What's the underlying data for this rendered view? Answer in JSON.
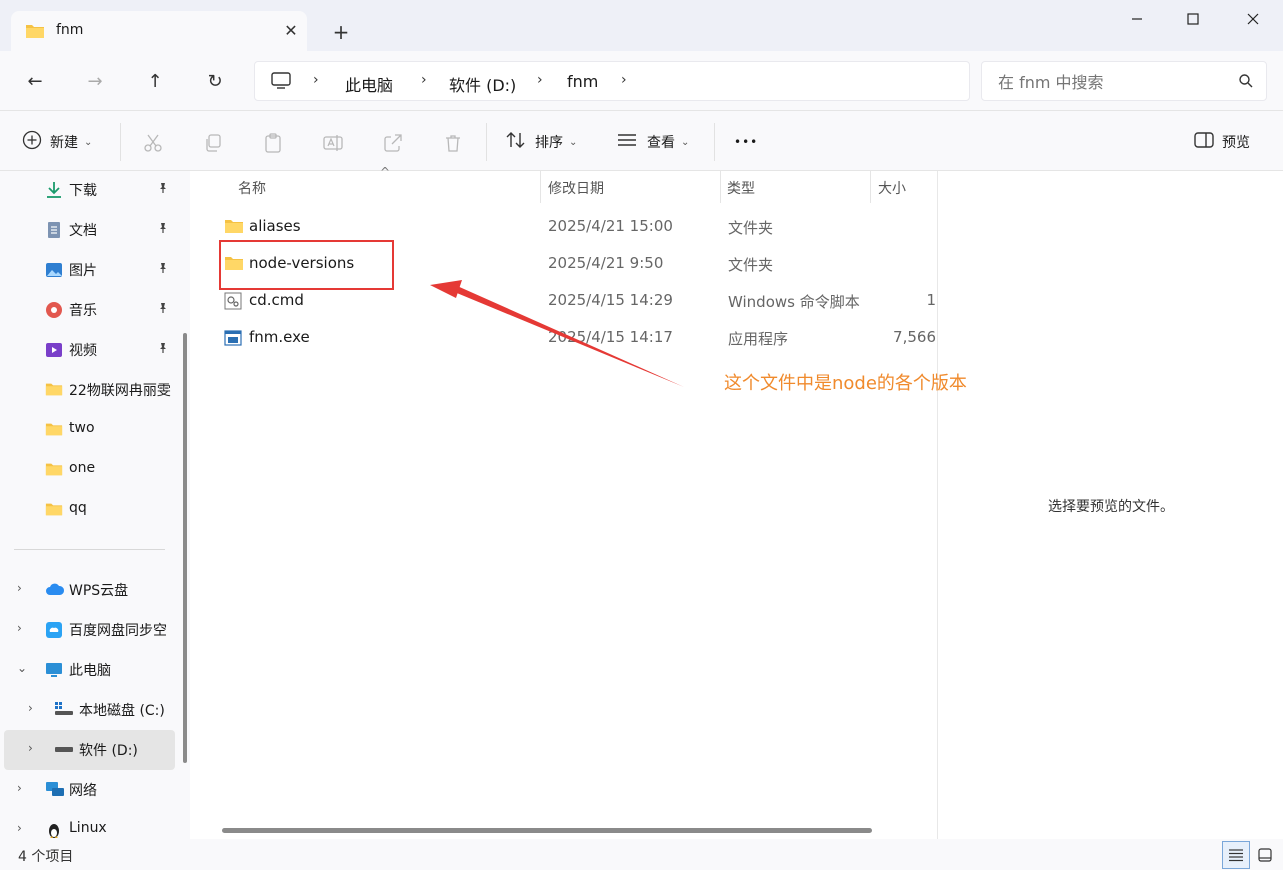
{
  "tab": {
    "title": "fnm",
    "close": "✕",
    "new": "+"
  },
  "window": {
    "minimize": "—",
    "maximize": "☐",
    "close": "✕"
  },
  "nav": {
    "back": "←",
    "forward": "→",
    "up": "↑",
    "refresh": "↻",
    "breadcrumb": [
      "此电脑",
      "软件 (D:)",
      "fnm"
    ],
    "chevron": "›",
    "search_placeholder": "在 fnm 中搜索"
  },
  "toolbar": {
    "new_label": "新建",
    "sort_label": "排序",
    "view_label": "查看",
    "more_label": "•••",
    "preview_label": "预览",
    "dropdown": "⌄"
  },
  "sidebar": {
    "quick": [
      {
        "label": "下载",
        "icon": "download-icon",
        "pinned": true
      },
      {
        "label": "文档",
        "icon": "document-icon",
        "pinned": true
      },
      {
        "label": "图片",
        "icon": "picture-icon",
        "pinned": true
      },
      {
        "label": "音乐",
        "icon": "music-icon",
        "pinned": true
      },
      {
        "label": "视频",
        "icon": "video-icon",
        "pinned": true
      },
      {
        "label": "22物联网冉丽雯",
        "icon": "folder-icon",
        "pinned": false
      },
      {
        "label": "two",
        "icon": "folder-icon",
        "pinned": false
      },
      {
        "label": "one",
        "icon": "folder-icon",
        "pinned": false
      },
      {
        "label": "qq",
        "icon": "folder-icon",
        "pinned": false
      }
    ],
    "tree": [
      {
        "label": "WPS云盘",
        "icon": "cloud-icon",
        "expand": "›"
      },
      {
        "label": "百度网盘同步空",
        "icon": "baidu-netdisk-icon",
        "expand": "›"
      },
      {
        "label": "此电脑",
        "icon": "computer-icon",
        "expand": "⌄"
      },
      {
        "label": "本地磁盘 (C:)",
        "icon": "windows-drive-icon",
        "expand": "›"
      },
      {
        "label": "软件 (D:)",
        "icon": "drive-icon",
        "expand": "›"
      },
      {
        "label": "网络",
        "icon": "network-icon",
        "expand": "›"
      },
      {
        "label": "Linux",
        "icon": "linux-penguin-icon",
        "expand": "›"
      }
    ],
    "pin_glyph": "📌"
  },
  "columns": {
    "name": "名称",
    "date": "修改日期",
    "type": "类型",
    "size": "大小",
    "sort_caret": "^"
  },
  "files": [
    {
      "name": "aliases",
      "date": "2025/4/21 15:00",
      "type": "文件夹",
      "size": "",
      "icon": "folder-icon"
    },
    {
      "name": "node-versions",
      "date": "2025/4/21 9:50",
      "type": "文件夹",
      "size": "",
      "icon": "folder-icon"
    },
    {
      "name": "cd.cmd",
      "date": "2025/4/15 14:29",
      "type": "Windows 命令脚本",
      "size": "1",
      "icon": "cmd-script-icon"
    },
    {
      "name": "fnm.exe",
      "date": "2025/4/15 14:17",
      "type": "应用程序",
      "size": "7,566",
      "icon": "exe-icon"
    }
  ],
  "annotation": {
    "text": "这个文件中是node的各个版本",
    "color": "#f08a2c",
    "box_color": "#e53935"
  },
  "preview": {
    "text": "选择要预览的文件。"
  },
  "status": {
    "count": "4 个项目"
  },
  "colors": {
    "accent": "#0067c0",
    "folder": "#f5c244",
    "chrome": "#eef0f7"
  }
}
